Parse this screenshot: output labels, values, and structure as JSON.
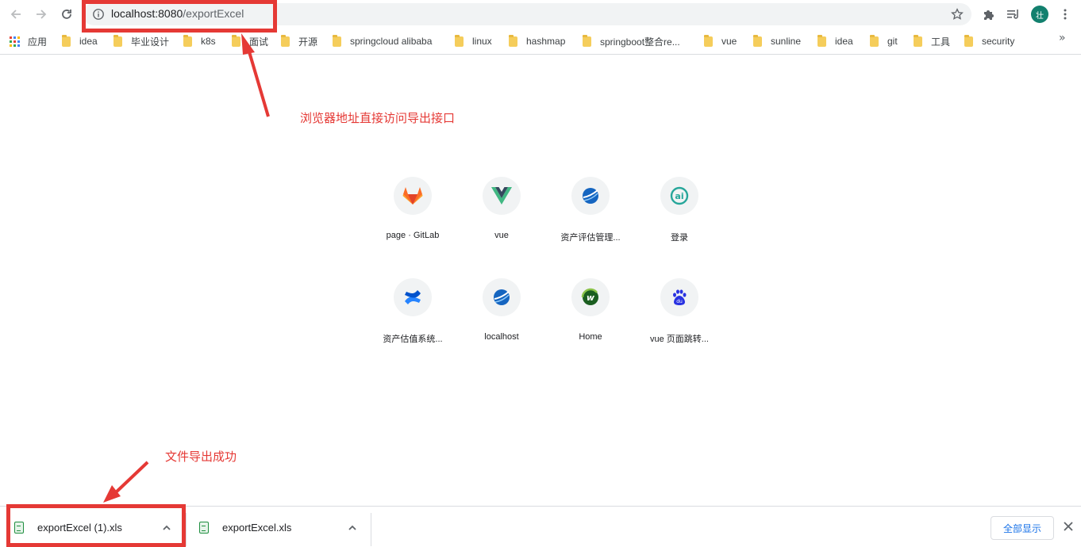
{
  "browser": {
    "url_host": "localhost:8080",
    "url_path": "/exportExcel",
    "avatar_initial": "壮",
    "icons": [
      "back-arrow-icon",
      "forward-arrow-icon",
      "reload-icon",
      "info-icon",
      "star-icon",
      "extensions-puzzle-icon",
      "reading-list-icon",
      "more-vertical-icon"
    ]
  },
  "bookmarks": {
    "apps_label": "应用",
    "items": [
      "idea",
      "毕业设计",
      "k8s",
      "面试",
      "开源",
      "springcloud alibaba",
      "linux",
      "hashmap",
      "springboot整合re...",
      "vue",
      "sunline",
      "idea",
      "git",
      "工具",
      "security"
    ],
    "overflow_glyph": "»"
  },
  "annotations": {
    "address_note": "浏览器地址直接访问导出接口",
    "download_note": "文件导出成功",
    "color": "#e53935"
  },
  "shortcuts": [
    {
      "label": "page · GitLab",
      "icon": "gitlab-icon"
    },
    {
      "label": "vue",
      "icon": "vue-icon"
    },
    {
      "label": "资产评估管理...",
      "icon": "globe-icon"
    },
    {
      "label": "登录",
      "icon": "login-logo-icon"
    },
    {
      "label": "资产估值系统...",
      "icon": "confluence-icon"
    },
    {
      "label": "localhost",
      "icon": "globe-icon"
    },
    {
      "label": "Home",
      "icon": "home-logo-icon"
    },
    {
      "label": "vue 页面跳转...",
      "icon": "baidu-icon"
    }
  ],
  "downloads": {
    "items": [
      {
        "name": "exportExcel (1).xls",
        "icon": "excel-file-icon"
      },
      {
        "name": "exportExcel.xls",
        "icon": "excel-file-icon"
      }
    ],
    "show_all_label": "全部显示"
  }
}
